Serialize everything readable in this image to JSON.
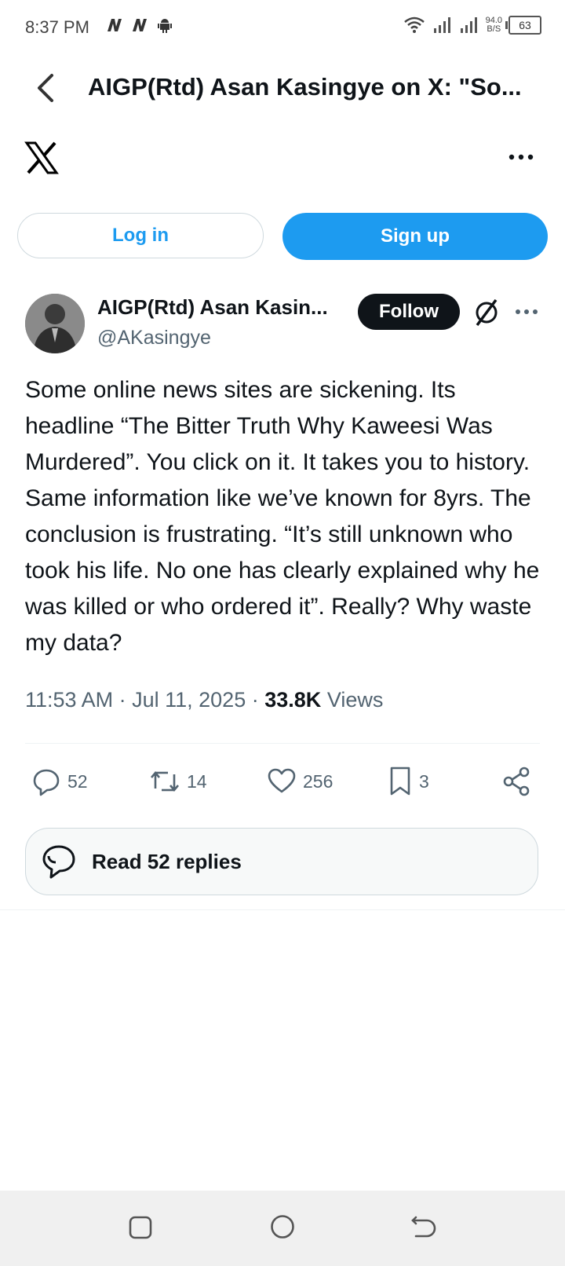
{
  "status_bar": {
    "time": "8:37 PM",
    "net_speed_value": "94.0",
    "net_speed_unit": "B/S",
    "battery": "63"
  },
  "header": {
    "title": "AIGP(Rtd) Asan Kasingye on X: \"So..."
  },
  "auth": {
    "login_label": "Log in",
    "signup_label": "Sign up"
  },
  "tweet": {
    "author_name": "AIGP(Rtd) Asan Kasin...",
    "author_handle": "@AKasingye",
    "follow_label": "Follow",
    "text": "Some online news sites are sickening. Its headline “The Bitter Truth Why Kaweesi Was Murdered”. You click on it. It takes you to history. Same information like we’ve known for 8yrs. The conclusion is frustrating. “It’s still unknown who took his life. No one has clearly explained why he was killed or who ordered it”. Really? Why waste my data?",
    "time": "11:53 AM",
    "date": "Jul 11, 2025",
    "views_count": "33.8K",
    "views_label": "Views",
    "replies": "52",
    "retweets": "14",
    "likes": "256",
    "bookmarks": "3",
    "read_replies_label": "Read 52 replies"
  },
  "colors": {
    "brand_blue": "#1d9bf0",
    "text_primary": "#0f1419",
    "text_secondary": "#536471"
  }
}
